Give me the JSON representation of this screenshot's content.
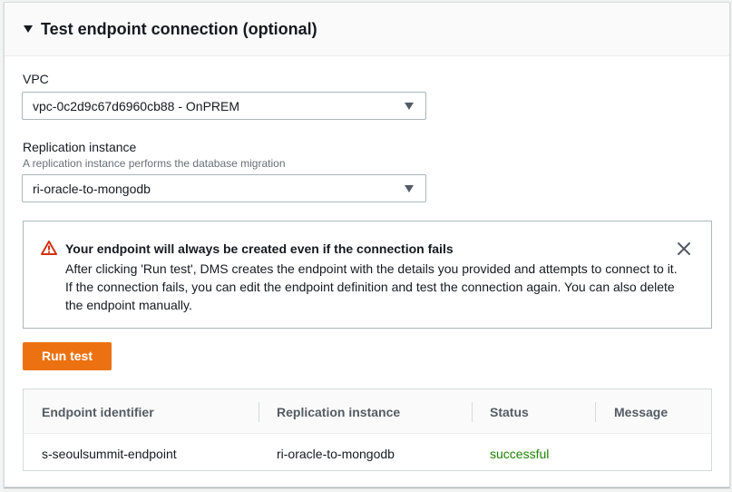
{
  "section": {
    "title": "Test endpoint connection (optional)"
  },
  "vpc": {
    "label": "VPC",
    "selected": "vpc-0c2d9c67d6960cb88 - OnPREM"
  },
  "replication": {
    "label": "Replication instance",
    "hint": "A replication instance performs the database migration",
    "selected": "ri-oracle-to-mongodb"
  },
  "alert": {
    "title": "Your endpoint will always be created even if the connection fails",
    "body": "After clicking 'Run test', DMS creates the endpoint with the details you provided and attempts to connect to it. If the connection fails, you can edit the endpoint definition and test the connection again. You can also delete the endpoint manually.",
    "icon": "warning-icon",
    "color": "#d13212"
  },
  "run_test": {
    "label": "Run test",
    "color": "#ec7211"
  },
  "table": {
    "headers": [
      "Endpoint identifier",
      "Replication instance",
      "Status",
      "Message"
    ],
    "rows": [
      {
        "endpoint": "s-seoulsummit-endpoint",
        "instance": "ri-oracle-to-mongodb",
        "status": "successful",
        "message": ""
      }
    ],
    "status_color": "#1d8102"
  }
}
